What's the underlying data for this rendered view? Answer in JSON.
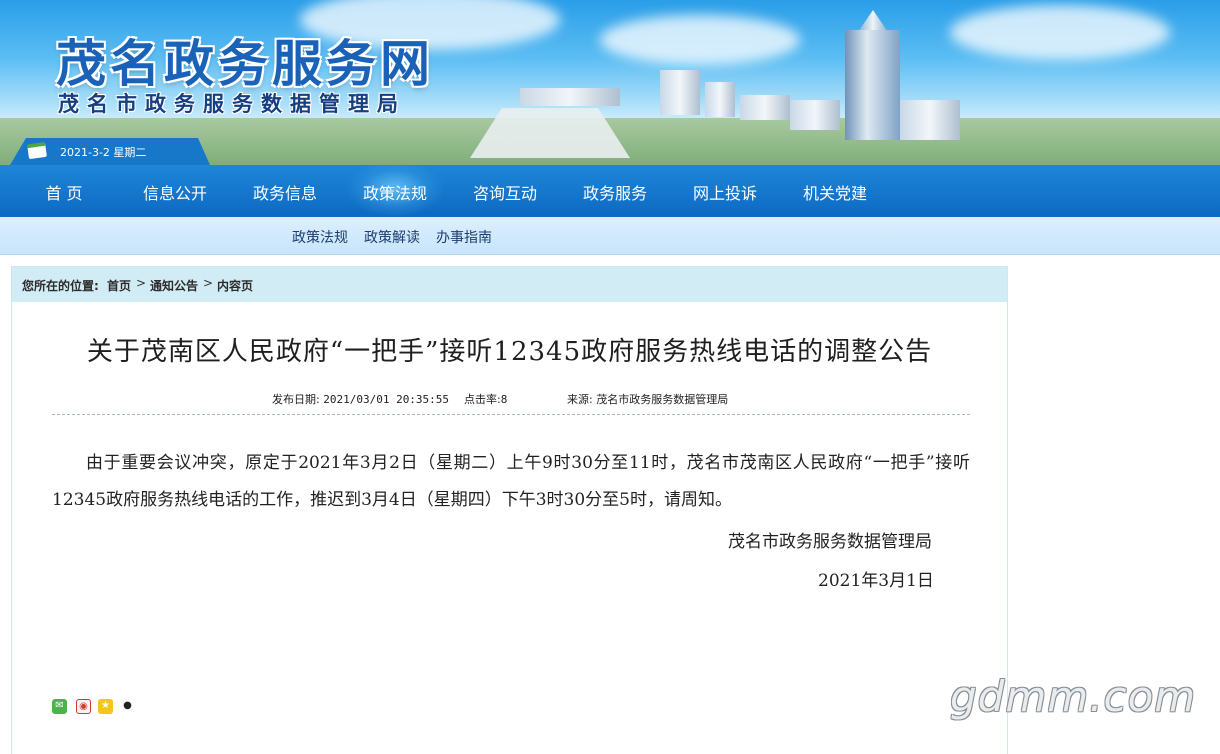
{
  "site": {
    "title": "茂名政务服务网",
    "subtitle": "茂名市政务服务数据管理局",
    "date": "2021-3-2 星期二"
  },
  "nav": {
    "items": [
      {
        "label": "首 页"
      },
      {
        "label": "信息公开"
      },
      {
        "label": "政务信息"
      },
      {
        "label": "政策法规",
        "active": true
      },
      {
        "label": "咨询互动"
      },
      {
        "label": "政务服务"
      },
      {
        "label": "网上投诉"
      },
      {
        "label": "机关党建"
      }
    ],
    "subitems": [
      {
        "label": "政策法规"
      },
      {
        "label": "政策解读"
      },
      {
        "label": "办事指南"
      }
    ]
  },
  "breadcrumb": {
    "prefix": "您所在的位置:",
    "items": [
      "首页",
      "通知公告",
      "内容页"
    ],
    "separator": ">"
  },
  "article": {
    "title": "关于茂南区人民政府“一把手”接听12345政府服务热线电话的调整公告",
    "publish_label": "发布日期:",
    "publish_date": "2021/03/01 20:35:55",
    "clicks_label": "点击率:",
    "clicks": "8",
    "source_label": "来源:",
    "source": "茂名市政务服务数据管理局",
    "body": "由于重要会议冲突，原定于2021年3月2日（星期二）上午9时30分至11时，茂名市茂南区人民政府“一把手”接听12345政府服务热线电话的工作，推迟到3月4日（星期四）下午3时30分至5时，请周知。",
    "signature": "茂名市政务服务数据管理局",
    "sign_date": "2021年3月1日"
  },
  "share_icons": [
    "wechat-icon",
    "weibo-icon",
    "qzone-icon",
    "qq-icon"
  ],
  "watermark": "gdmm.com",
  "colors": {
    "nav_bg": "#0d69c2",
    "title_blue": "#1a62b7",
    "subnav_bg": "#c8e4fa",
    "crumb_bg": "#d2ecf6"
  }
}
